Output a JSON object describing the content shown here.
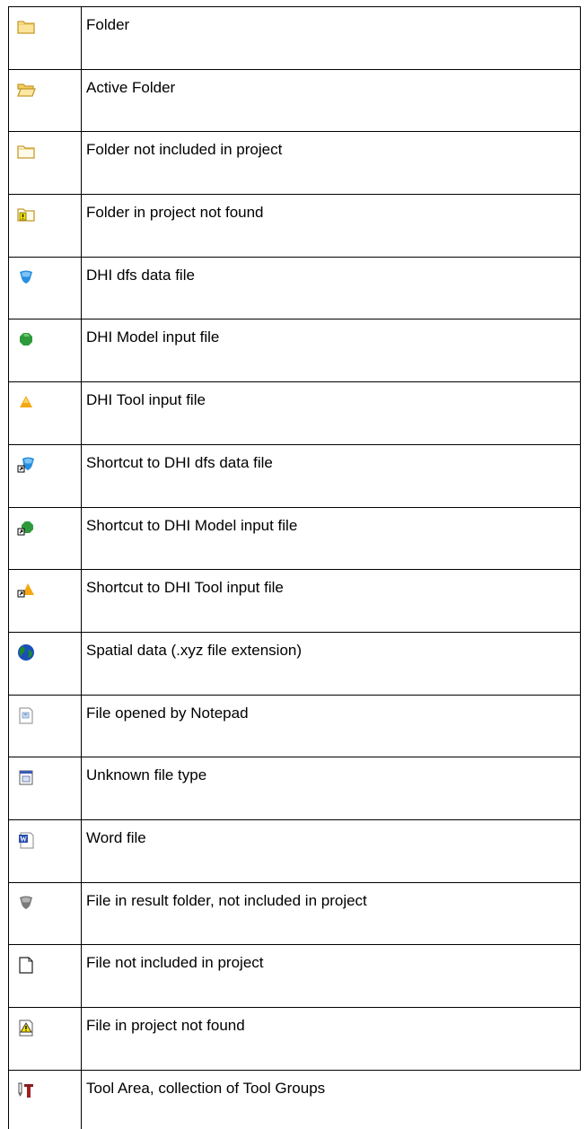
{
  "rows": [
    {
      "icon": "folder-icon",
      "label": "Folder"
    },
    {
      "icon": "open-folder-icon",
      "label": "Active Folder"
    },
    {
      "icon": "outline-folder-icon",
      "label": "Folder not included in project"
    },
    {
      "icon": "folder-warning-icon",
      "label": "Folder in project not found"
    },
    {
      "icon": "dfs-data-file-icon",
      "label": "DHI dfs data file"
    },
    {
      "icon": "model-input-file-icon",
      "label": "DHI Model input file"
    },
    {
      "icon": "tool-input-file-icon",
      "label": "DHI Tool input file"
    },
    {
      "icon": "dfs-shortcut-icon",
      "label": "Shortcut to DHI dfs data file"
    },
    {
      "icon": "model-shortcut-icon",
      "label": "Shortcut to DHI Model input file"
    },
    {
      "icon": "tool-shortcut-icon",
      "label": "Shortcut to DHI Tool input file"
    },
    {
      "icon": "globe-icon",
      "label": "Spatial data (.xyz file extension)"
    },
    {
      "icon": "notepad-file-icon",
      "label": "File opened by Notepad"
    },
    {
      "icon": "unknown-file-icon",
      "label": "Unknown file type"
    },
    {
      "icon": "word-file-icon",
      "label": "Word file"
    },
    {
      "icon": "result-file-icon",
      "label": "File in result folder, not included in project"
    },
    {
      "icon": "blank-file-icon",
      "label": "File not included in project"
    },
    {
      "icon": "file-warning-icon",
      "label": "File in project not found"
    },
    {
      "icon": "tool-area-icon",
      "label": "Tool Area, collection of Tool Groups"
    }
  ]
}
